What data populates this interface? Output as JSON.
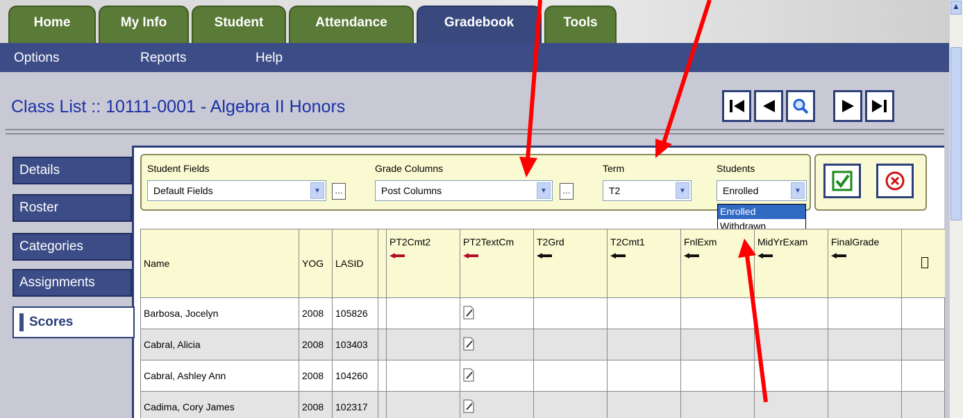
{
  "tabs": [
    {
      "label": "Home",
      "active": false
    },
    {
      "label": "My Info",
      "active": false
    },
    {
      "label": "Student",
      "active": false
    },
    {
      "label": "Attendance",
      "active": false
    },
    {
      "label": "Gradebook",
      "active": true
    },
    {
      "label": "Tools",
      "active": false
    }
  ],
  "menu": {
    "options": "Options",
    "reports": "Reports",
    "help": "Help"
  },
  "page_title": "Class List :: 10111-0001 - Algebra II Honors",
  "nav_buttons": [
    "first-icon",
    "previous-icon",
    "search-icon",
    "next-icon",
    "last-icon"
  ],
  "side_tabs": [
    {
      "label": "Details",
      "active": false
    },
    {
      "label": "Roster",
      "active": false
    },
    {
      "label": "Categories",
      "active": false
    },
    {
      "label": "Assignments",
      "active": false
    },
    {
      "label": "Scores",
      "active": true
    }
  ],
  "filters": {
    "student_fields": {
      "label": "Student Fields",
      "value": "Default Fields"
    },
    "grade_columns": {
      "label": "Grade Columns",
      "value": "Post Columns"
    },
    "term": {
      "label": "Term",
      "value": "T2"
    },
    "students": {
      "label": "Students",
      "value": "Enrolled",
      "options": [
        "Enrolled",
        "Withdrawn"
      ],
      "highlighted": "Enrolled"
    }
  },
  "actions": {
    "apply": "checkmark-icon",
    "cancel": "cancel-icon"
  },
  "grid": {
    "columns": [
      {
        "label": "Name",
        "pin": null
      },
      {
        "label": "YOG",
        "pin": null
      },
      {
        "label": "LASID",
        "pin": null
      },
      {
        "label": "",
        "pin": null
      },
      {
        "label": "PT2Cmt2",
        "pin": "red"
      },
      {
        "label": "PT2TextCm",
        "pin": "red"
      },
      {
        "label": "T2Grd",
        "pin": "black"
      },
      {
        "label": "T2Cmt1",
        "pin": "black"
      },
      {
        "label": "FnlExm",
        "pin": "black"
      },
      {
        "label": "MidYrExam",
        "pin": "black"
      },
      {
        "label": "FinalGrade",
        "pin": "black"
      }
    ],
    "rows": [
      {
        "name": "Barbosa, Jocelyn",
        "yog": "2008",
        "lasid": "105826"
      },
      {
        "name": "Cabral, Alicia",
        "yog": "2008",
        "lasid": "103403"
      },
      {
        "name": "Cabral, Ashley Ann",
        "yog": "2008",
        "lasid": "104260"
      },
      {
        "name": "Cadima, Cory James",
        "yog": "2008",
        "lasid": "102317"
      }
    ]
  },
  "colors": {
    "tab_green": "#5a7a38",
    "tab_active": "#39497e",
    "menu_bg": "#3c4c86",
    "title_blue": "#1b30a8",
    "filter_bg": "#fafad2",
    "annotation_red": "#ff0000"
  }
}
